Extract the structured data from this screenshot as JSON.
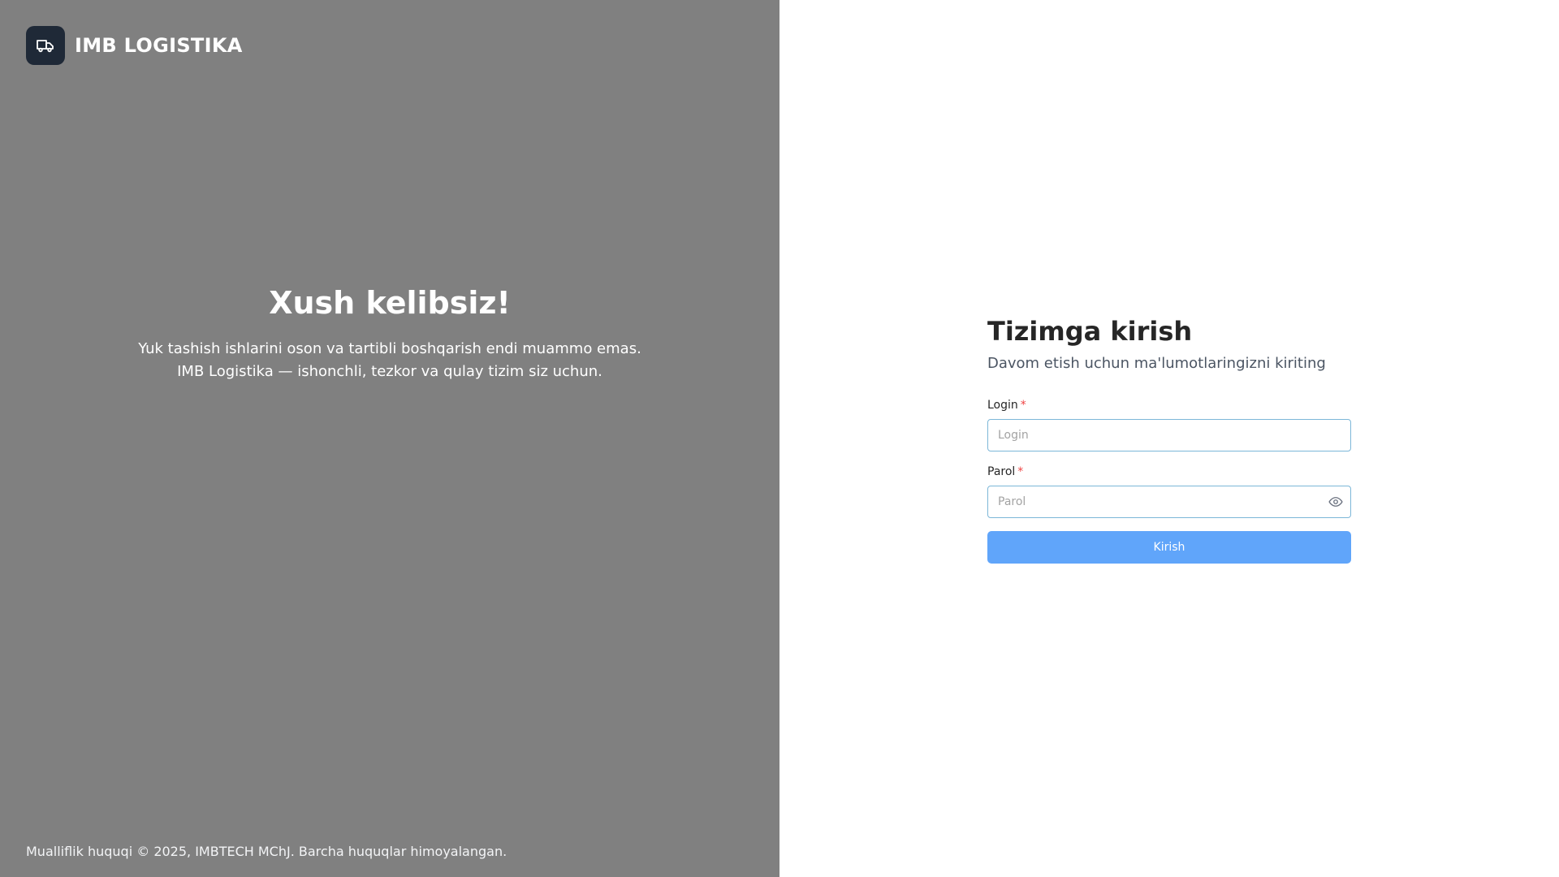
{
  "brand": {
    "name": "IMB LOGISTIKA",
    "logo_icon": "truck-icon",
    "logo_bg": "#1f2937"
  },
  "welcome": {
    "title": "Xush kelibsiz!",
    "line1": "Yuk tashish ishlarini oson va tartibli boshqarish endi muammo emas.",
    "line2": "IMB Logistika — ishonchli, tezkor va qulay tizim siz uchun."
  },
  "footer": {
    "copyright": "Mualliflik huquqi © 2025, IMBTECH MChJ. Barcha huquqlar himoyalangan."
  },
  "login_form": {
    "title": "Tizimga kirish",
    "subtitle": "Davom etish uchun ma'lumotlaringizni kiriting",
    "login": {
      "label": "Login",
      "required_mark": "*",
      "value": "",
      "placeholder": "Login"
    },
    "password": {
      "label": "Parol",
      "required_mark": "*",
      "value": "",
      "placeholder": "Parol",
      "toggle_icon": "eye-icon"
    },
    "submit_label": "Kirish"
  },
  "colors": {
    "left_panel_bg": "#808080",
    "submit_bg": "#60a5fa",
    "required": "#ef4444",
    "input_border": "#7cb7d8"
  }
}
